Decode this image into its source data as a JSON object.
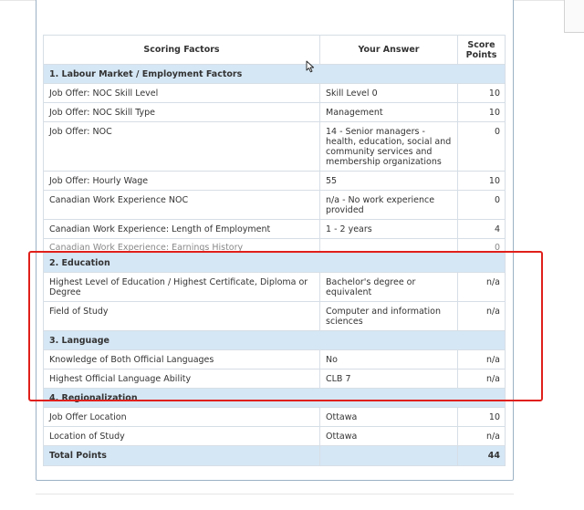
{
  "table": {
    "headers": {
      "factors": "Scoring Factors",
      "answer": "Your Answer",
      "points": "Score Points"
    },
    "sections": [
      {
        "title": "1. Labour Market / Employment Factors",
        "rows": [
          {
            "factor": "Job Offer: NOC Skill Level",
            "answer": "Skill Level 0",
            "points": "10"
          },
          {
            "factor": "Job Offer: NOC Skill Type",
            "answer": "Management",
            "points": "10"
          },
          {
            "factor": "Job Offer: NOC",
            "answer": "14 - Senior managers - health, education, social and community services and membership organizations",
            "points": "0"
          },
          {
            "factor": "Job Offer: Hourly Wage",
            "answer": "55",
            "points": "10"
          },
          {
            "factor": "Canadian Work Experience NOC",
            "answer": "n/a - No work experience provided",
            "points": "0"
          },
          {
            "factor": "Canadian Work Experience: Length of Employment",
            "answer": "1 - 2 years",
            "points": "4"
          },
          {
            "factor": "Canadian Work Experience: Earnings History",
            "answer": "",
            "points": "0"
          }
        ]
      },
      {
        "title": "2. Education",
        "rows": [
          {
            "factor": "Highest Level of Education / Highest Certificate, Diploma or Degree",
            "answer": "Bachelor's degree or equivalent",
            "points": "n/a"
          },
          {
            "factor": "Field of Study",
            "answer": "Computer and information sciences",
            "points": "n/a"
          }
        ]
      },
      {
        "title": "3. Language",
        "rows": [
          {
            "factor": "Knowledge of Both Official Languages",
            "answer": "No",
            "points": "n/a"
          },
          {
            "factor": "Highest Official Language Ability",
            "answer": "CLB 7",
            "points": "n/a"
          }
        ]
      },
      {
        "title": "4. Regionalization",
        "rows": [
          {
            "factor": "Job Offer Location",
            "answer": "Ottawa",
            "points": "10"
          },
          {
            "factor": "Location of Study",
            "answer": "Ottawa",
            "points": "n/a"
          }
        ]
      }
    ],
    "total": {
      "label": "Total Points",
      "points": "44"
    }
  },
  "colors": {
    "section_bg": "#d5e7f5",
    "border": "#d6dee6",
    "highlight": "#e0201b"
  },
  "icons": {
    "cursor": "mouse-pointer-icon"
  }
}
